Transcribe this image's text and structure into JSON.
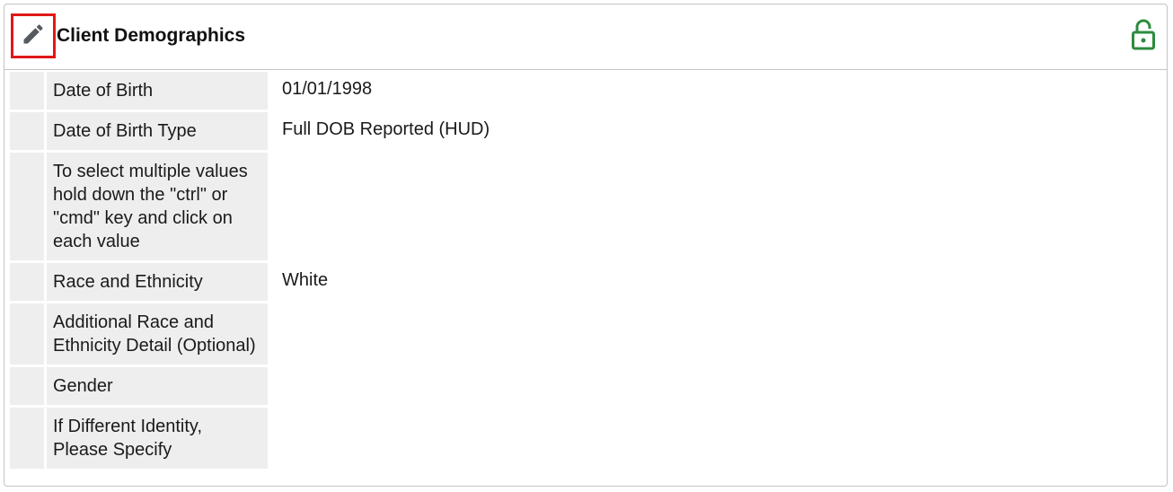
{
  "panel": {
    "title": "Client Demographics",
    "edit_icon": "pencil-icon",
    "lock_icon": "unlocked-padlock-icon",
    "lock_color": "#2e8b3e",
    "highlight_color": "#e01818"
  },
  "fields": [
    {
      "label": "Date of Birth",
      "value": "01/01/1998"
    },
    {
      "label": "Date of Birth Type",
      "value": "Full DOB Reported (HUD)"
    },
    {
      "label": "To select multiple values hold down the \"ctrl\" or \"cmd\" key and click on each value",
      "value": ""
    },
    {
      "label": "Race and Ethnicity",
      "value": "White"
    },
    {
      "label": "Additional Race and Ethnicity Detail (Optional)",
      "value": ""
    },
    {
      "label": "Gender",
      "value": ""
    },
    {
      "label": "If Different Identity, Please Specify",
      "value": ""
    }
  ]
}
